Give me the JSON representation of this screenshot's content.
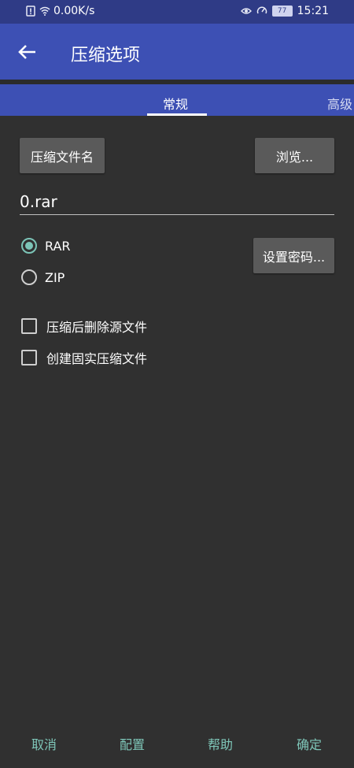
{
  "status_bar": {
    "net_speed": "0.00K/s",
    "battery": "77",
    "time": "15:21"
  },
  "app_bar": {
    "title": "压缩选项"
  },
  "tabs": [
    {
      "label": "常规",
      "active": true
    },
    {
      "label": "高级",
      "active": false
    }
  ],
  "form": {
    "filename_button": "压缩文件名",
    "browse_button": "浏览...",
    "filename_value": "0.rar",
    "format_options": [
      {
        "label": "RAR",
        "checked": true
      },
      {
        "label": "ZIP",
        "checked": false
      }
    ],
    "password_button": "设置密码...",
    "checkboxes": [
      {
        "label": "压缩后删除源文件",
        "checked": false
      },
      {
        "label": "创建固实压缩文件",
        "checked": false
      }
    ]
  },
  "bottom_actions": {
    "cancel": "取消",
    "config": "配置",
    "help": "帮助",
    "ok": "确定"
  },
  "colors": {
    "primary": "#3d50b4",
    "status_bar": "#2f3b86",
    "background": "#303030",
    "accent": "#7ec6b8"
  }
}
